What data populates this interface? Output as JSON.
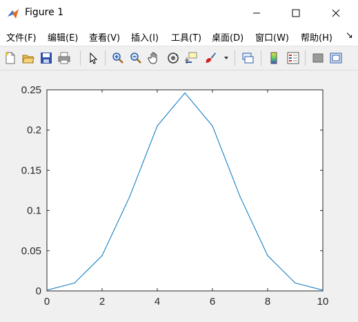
{
  "window": {
    "title": "Figure 1",
    "controls": {
      "minimize": "—",
      "maximize": "☐",
      "close": "✕"
    }
  },
  "menu": {
    "items": [
      {
        "label": "文件(F)"
      },
      {
        "label": "编辑(E)"
      },
      {
        "label": "查看(V)"
      },
      {
        "label": "插入(I)"
      },
      {
        "label": "工具(T)"
      },
      {
        "label": "桌面(D)"
      },
      {
        "label": "窗口(W)"
      },
      {
        "label": "帮助(H)"
      }
    ],
    "overflow": "↘"
  },
  "toolbar": {
    "icons": [
      "new-figure-icon",
      "open-file-icon",
      "save-icon",
      "print-icon",
      "edit-plot-arrow-icon",
      "zoom-in-icon",
      "zoom-out-icon",
      "pan-hand-icon",
      "rotate-3d-icon",
      "data-cursor-icon",
      "brush-icon",
      "link-plot-icon",
      "insert-colorbar-icon",
      "insert-legend-icon",
      "hide-plot-tools-icon",
      "show-plot-tools-icon"
    ]
  },
  "chart_data": {
    "type": "line",
    "x": [
      0,
      1,
      2,
      3,
      4,
      5,
      6,
      7,
      8,
      9,
      10
    ],
    "series": [
      {
        "values": [
          0.001,
          0.0098,
          0.0439,
          0.1172,
          0.2051,
          0.2461,
          0.2051,
          0.1172,
          0.0439,
          0.0098,
          0.001
        ],
        "color": "#0072bd"
      }
    ],
    "xlim": [
      0,
      10
    ],
    "ylim": [
      0,
      0.25
    ],
    "xticks": [
      "0",
      "2",
      "4",
      "6",
      "8",
      "10"
    ],
    "yticks": [
      "0",
      "0.05",
      "0.1",
      "0.15",
      "0.2",
      "0.25"
    ],
    "title": "",
    "xlabel": "",
    "ylabel": "",
    "grid": false
  }
}
